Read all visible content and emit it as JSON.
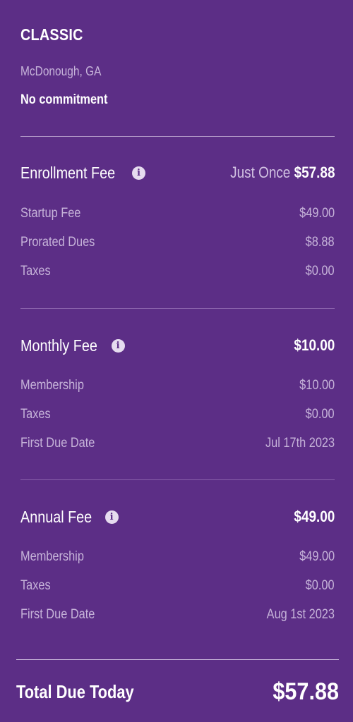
{
  "plan": {
    "name": "CLASSIC",
    "location": "McDonough, GA",
    "commitment": "No commitment"
  },
  "enrollment": {
    "title": "Enrollment Fee",
    "icon": "info-icon",
    "amount_prefix": "Just Once",
    "amount": "$57.88",
    "rows": [
      {
        "label": "Startup Fee",
        "value": "$49.00"
      },
      {
        "label": "Prorated Dues",
        "value": "$8.88"
      },
      {
        "label": "Taxes",
        "value": "$0.00"
      }
    ]
  },
  "monthly": {
    "title": "Monthly Fee",
    "icon": "info-icon",
    "amount": "$10.00",
    "rows": [
      {
        "label": "Membership",
        "value": "$10.00"
      },
      {
        "label": "Taxes",
        "value": "$0.00"
      },
      {
        "label": "First Due Date",
        "value": "Jul 17th 2023"
      }
    ]
  },
  "annual": {
    "title": "Annual Fee",
    "icon": "info-icon",
    "amount": "$49.00",
    "rows": [
      {
        "label": "Membership",
        "value": "$49.00"
      },
      {
        "label": "Taxes",
        "value": "$0.00"
      },
      {
        "label": "First Due Date",
        "value": "Aug 1st 2023"
      }
    ]
  },
  "total": {
    "label": "Total Due Today",
    "value": "$57.88"
  },
  "colors": {
    "background": "#5c2e86",
    "primary_text": "#ffffff",
    "secondary_text": "#c6b3d9"
  }
}
